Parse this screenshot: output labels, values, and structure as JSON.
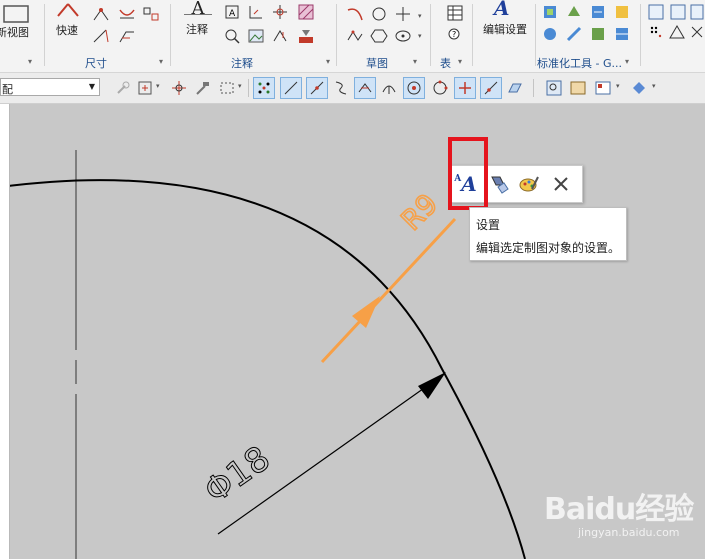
{
  "ribbon": {
    "groups": [
      {
        "label": "尺寸"
      },
      {
        "label": "注释"
      },
      {
        "label": "草图"
      },
      {
        "label": "表"
      },
      {
        "label": "标准化工具 - G..."
      }
    ],
    "buttons": {
      "view_label": "新视图",
      "rapid_label": "快速",
      "note_label": "注释",
      "edit_settings_label": "编辑设置"
    }
  },
  "toolbar": {
    "filter_value": "配"
  },
  "drawing": {
    "radius_dim": "R9",
    "diameter_dim": "Φ18",
    "line_color": "#000000",
    "dim_color": "#f7a047"
  },
  "popup": {
    "buttons": [
      {
        "icon": "settings-icon"
      },
      {
        "icon": "style-icon"
      },
      {
        "icon": "palette-icon"
      },
      {
        "icon": "close-icon"
      }
    ],
    "highlight_color": "#e5141d"
  },
  "tooltip": {
    "title": "设置",
    "description": "编辑选定制图对象的设置。"
  },
  "watermark": {
    "text": "Baidu经验",
    "url": "jingyan.baidu.com"
  }
}
